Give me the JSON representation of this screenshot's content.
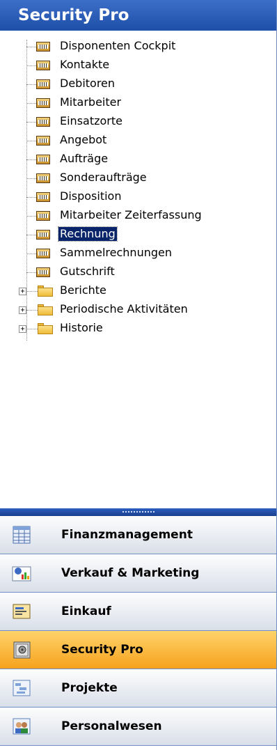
{
  "pane": {
    "title": "Security Pro"
  },
  "tree": {
    "items": [
      {
        "label": "Disponenten Cockpit",
        "icon": "form-icon",
        "selected": false
      },
      {
        "label": "Kontakte",
        "icon": "form-icon",
        "selected": false
      },
      {
        "label": "Debitoren",
        "icon": "form-icon",
        "selected": false
      },
      {
        "label": "Mitarbeiter",
        "icon": "form-icon",
        "selected": false
      },
      {
        "label": "Einsatzorte",
        "icon": "form-icon",
        "selected": false
      },
      {
        "label": "Angebot",
        "icon": "form-icon",
        "selected": false
      },
      {
        "label": "Aufträge",
        "icon": "form-icon",
        "selected": false
      },
      {
        "label": "Sonderaufträge",
        "icon": "form-icon",
        "selected": false
      },
      {
        "label": "Disposition",
        "icon": "form-icon",
        "selected": false
      },
      {
        "label": "Mitarbeiter Zeiterfassung",
        "icon": "form-icon",
        "selected": false
      },
      {
        "label": "Rechnung",
        "icon": "form-icon",
        "selected": true
      },
      {
        "label": "Sammelrechnungen",
        "icon": "form-icon",
        "selected": false
      },
      {
        "label": "Gutschrift",
        "icon": "form-icon",
        "selected": false
      }
    ],
    "folders": [
      {
        "label": "Berichte",
        "icon": "folder-icon",
        "expander": "+"
      },
      {
        "label": "Periodische Aktivitäten",
        "icon": "folder-icon",
        "expander": "+"
      },
      {
        "label": "Historie",
        "icon": "folder-icon",
        "expander": "+"
      }
    ]
  },
  "nav": {
    "buttons": [
      {
        "label": "Finanzmanagement",
        "icon": "ledger-icon",
        "active": false
      },
      {
        "label": "Verkauf & Marketing",
        "icon": "sales-chart-icon",
        "active": false
      },
      {
        "label": "Einkauf",
        "icon": "purchase-icon",
        "active": false
      },
      {
        "label": "Security Pro",
        "icon": "safe-icon",
        "active": true
      },
      {
        "label": "Projekte",
        "icon": "project-icon",
        "active": false
      },
      {
        "label": "Personalwesen",
        "icon": "people-icon",
        "active": false
      }
    ]
  },
  "colors": {
    "title_bg": "#2a5bb8",
    "selected_bg": "#0a246a",
    "active_button": "#f6a21d"
  }
}
